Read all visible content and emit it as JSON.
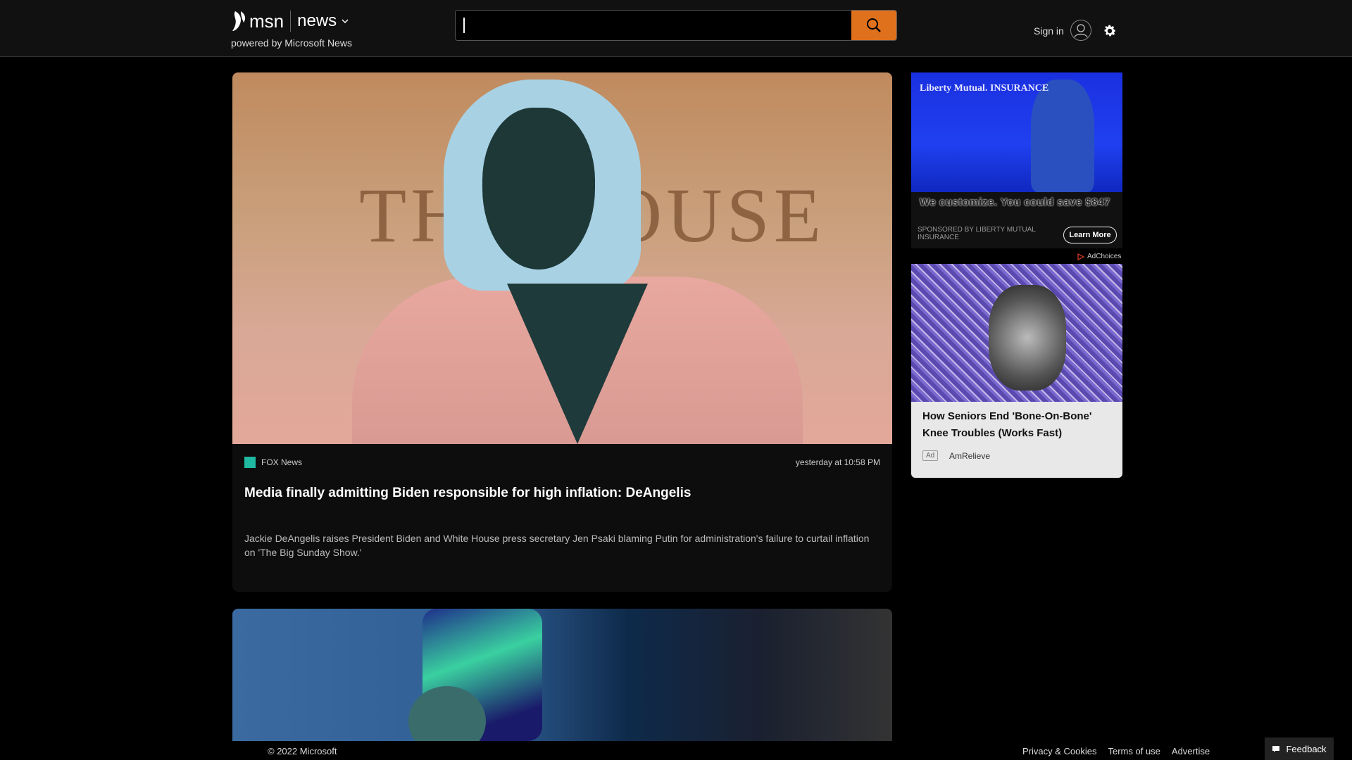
{
  "header": {
    "logo_text": "msn",
    "section": "news",
    "powered_by": "powered by Microsoft News",
    "search": {
      "value": "",
      "placeholder": ""
    },
    "sign_in": "Sign in"
  },
  "main_card": {
    "source": "FOX News",
    "timestamp": "yesterday at 10:58 PM",
    "headline": "Media finally admitting Biden responsible for high inflation: DeAngelis",
    "summary": "Jackie DeAngelis raises President Biden and White House press secretary Jen Psaki blaming Putin for administration's failure to curtail inflation on 'The Big Sunday Show.'",
    "hero_text": "THE HOUSE"
  },
  "ad1": {
    "brand": "Liberty Mutual. INSURANCE",
    "tagline": "We customize. You could save $847",
    "sponsor": "SPONSORED BY LIBERTY MUTUAL INSURANCE",
    "cta": "Learn More"
  },
  "adchoices": "AdChoices",
  "ad2": {
    "title": "How Seniors End 'Bone-On-Bone' Knee Troubles (Works Fast)",
    "ad_label": "Ad",
    "advertiser": "AmRelieve"
  },
  "footer": {
    "copyright": "© 2022 Microsoft",
    "links": [
      "Privacy & Cookies",
      "Terms of use",
      "Advertise"
    ],
    "feedback": "Feedback"
  },
  "colors": {
    "accent": "#e0711c",
    "background": "#000000"
  }
}
